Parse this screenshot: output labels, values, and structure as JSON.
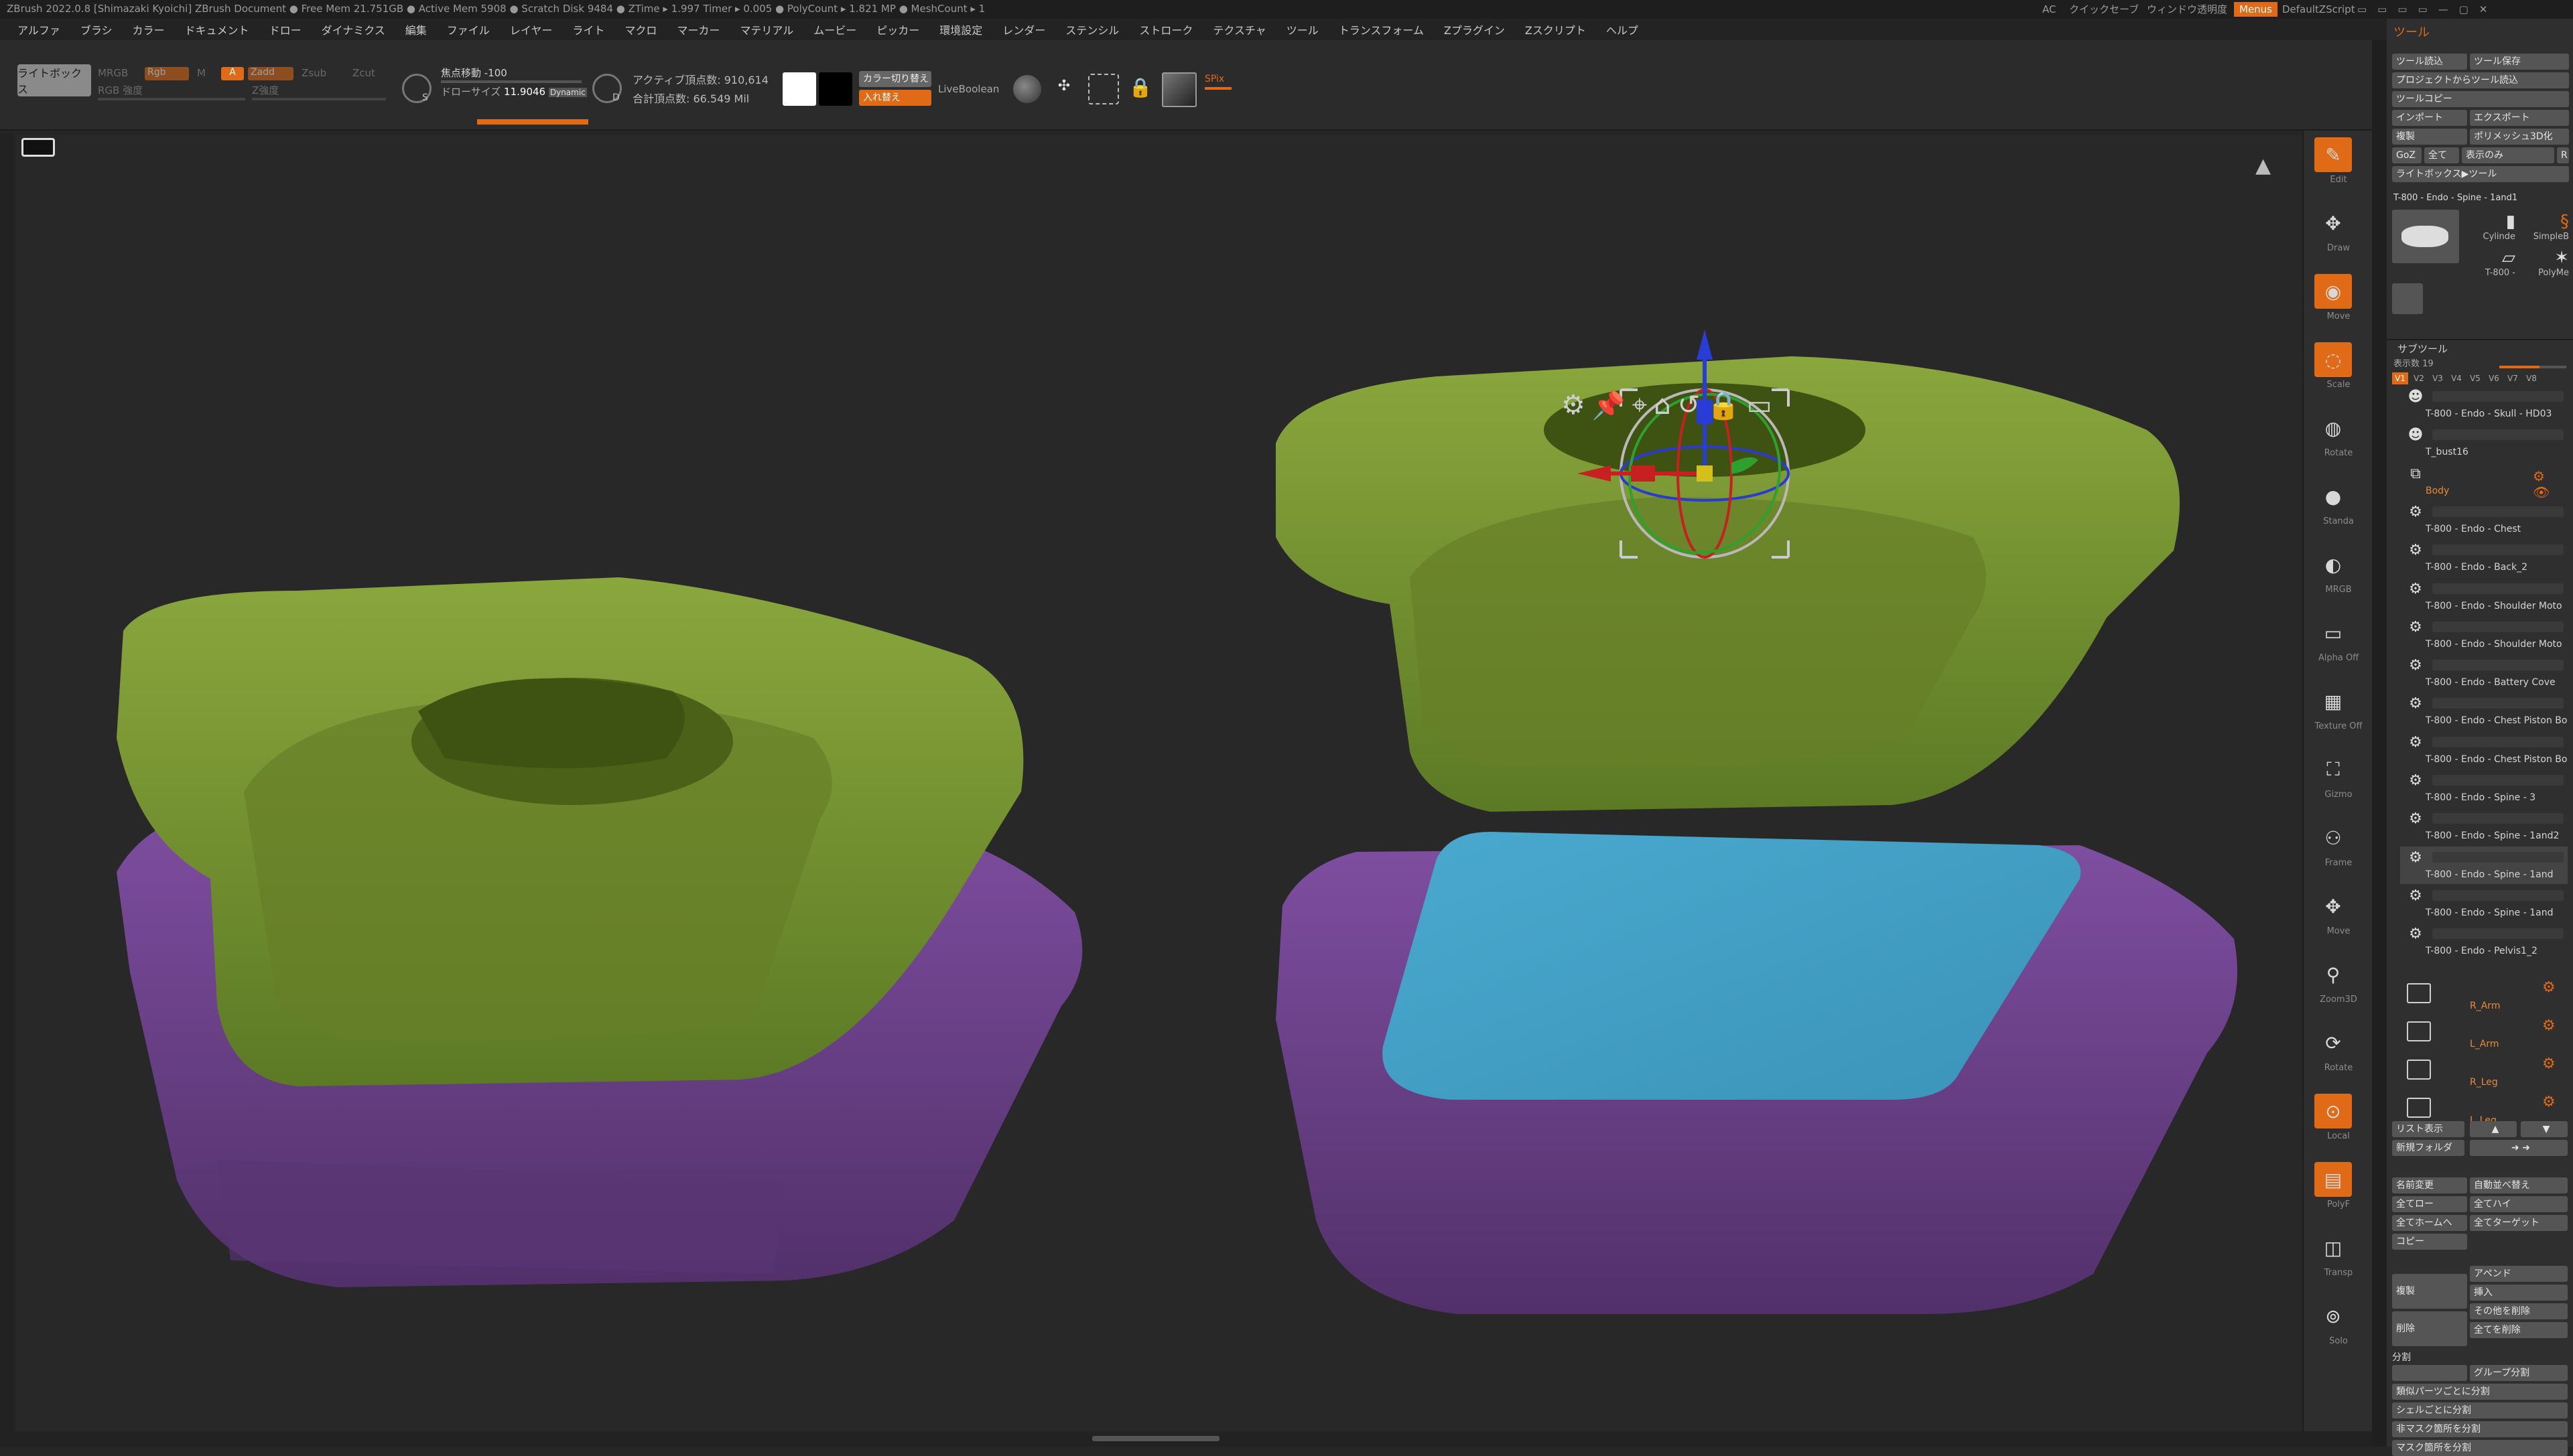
{
  "titlebar": {
    "title": "ZBrush 2022.0.8 [Shimazaki Kyoichi]   ZBrush Document   ● Free Mem 21.751GB ● Active Mem 5908 ● Scratch Disk 9484 ● ZTime ▸ 1.997 Timer ▸ 0.005 ● PolyCount ▸ 1.821 MP ● MeshCount ▸ 1",
    "ac": "AC",
    "quicksave": "クイックセーブ",
    "transparency": "ウィンドウ透明度",
    "menus": "Menus",
    "script": "DefaultZScript"
  },
  "menu": [
    "アルファ",
    "ブラシ",
    "カラー",
    "ドキュメント",
    "ドロー",
    "ダイナミクス",
    "編集",
    "ファイル",
    "レイヤー",
    "ライト",
    "マクロ",
    "マーカー",
    "マテリアル",
    "ムービー",
    "ピッカー",
    "環境設定",
    "レンダー",
    "ステンシル",
    "ストローク",
    "テクスチャ",
    "ツール",
    "トランスフォーム",
    "Zプラグイン",
    "Zスクリプト",
    "ヘルプ"
  ],
  "toolbar": {
    "lightbox": "ライトボックス",
    "mrgb": "MRGB",
    "rgb": "Rgb",
    "m": "M",
    "zadd": "Zadd",
    "zsub": "Zsub",
    "a": "A",
    "zcut": "Zcut",
    "rgb_intensity": "RGB 強度",
    "z_intensity": "Z強度",
    "focal_shift": "焦点移動 -100",
    "draw_size_label": "ドローサイズ",
    "draw_size_value": "11.9046",
    "dynamic": "Dynamic",
    "active_points": "アクティブ頂点数: 910,614",
    "total_points": "合計頂点数: 66.549 Mil",
    "color_switch": "カラー切り替え",
    "swap": "入れ替え",
    "liveboolean": "LiveBoolean",
    "spix": "SPix",
    "s": "S",
    "d": "D"
  },
  "panel": {
    "title": "ツール",
    "buttons": [
      [
        "ツール読込",
        "ツール保存"
      ],
      [
        "プロジェクトからツール読込",
        ""
      ],
      [
        "ツールコピー",
        ""
      ],
      [
        "インポート",
        "エクスポート"
      ],
      [
        "複製",
        "ポリメッシュ3D化"
      ],
      [
        "GoZ",
        "全て",
        "表示のみ",
        "R"
      ],
      [
        "ライトボックス▶ツール",
        ""
      ]
    ],
    "current_tool": "T-800 - Endo - Spine - 1and1",
    "thumbs": [
      "Cylinde",
      "SimpleB",
      "T-800 - ",
      "PolyMe"
    ],
    "subtool_header": "サブツール",
    "visible_count": "表示数 19",
    "versions": [
      "V1",
      "V2",
      "V3",
      "V4",
      "V5",
      "V6",
      "V7",
      "V8"
    ],
    "subtools": [
      "T-800 - Endo - Skull - HD03",
      "T_bust16",
      "Body",
      "T-800 - Endo - Chest",
      "T-800 - Endo - Back_2",
      "T-800 - Endo - Shoulder Moto",
      "T-800 - Endo - Shoulder Moto",
      "T-800 - Endo - Battery Cove",
      "T-800 - Endo - Chest Piston Bo",
      "T-800 - Endo - Chest Piston Bo",
      "T-800 - Endo - Spine - 3",
      "T-800 - Endo - Spine - 1and2",
      "T-800 - Endo - Spine - 1and",
      "T-800 - Endo - Spine - 1and",
      "T-800 - Endo - Pelvis1_2"
    ],
    "folders": [
      "R_Arm",
      "L_Arm",
      "R_Leg",
      "L_Leg"
    ],
    "list_buttons": [
      "リスト表示",
      "新規フォルダ"
    ],
    "bottom_buttons": [
      [
        "名前変更",
        "自動並べ替え"
      ],
      [
        "全てロー",
        "全てハイ"
      ],
      [
        "全てホームへ",
        "全てターゲット"
      ],
      [
        "コピー",
        ""
      ],
      [
        "アペンド",
        ""
      ],
      [
        "挿入",
        ""
      ],
      [
        "その他を削除",
        ""
      ],
      [
        "全てを削除",
        ""
      ]
    ],
    "dup": "複製",
    "del": "削除",
    "split_header": "分割",
    "split_group": "グループ分割",
    "split_buttons": [
      "類似パーツごとに分割",
      "シェルごとに分割",
      "非マスク箇所を分割",
      "マスク箇所を分割"
    ]
  },
  "shelf": [
    "Edit",
    "Draw",
    "Move",
    "Scale",
    "Rotate",
    "Standa",
    "MRGB",
    "Alpha Off",
    "Texture Off",
    "Gizmo",
    "Frame",
    "Move",
    "Zoom3D",
    "Rotate",
    "Local",
    "PolyF",
    "Transp",
    "Solo"
  ],
  "colors": {
    "accent": "#e06a16",
    "green": "#6f8a2e",
    "purple": "#6c3f8a",
    "blue": "#3b9cc2"
  }
}
